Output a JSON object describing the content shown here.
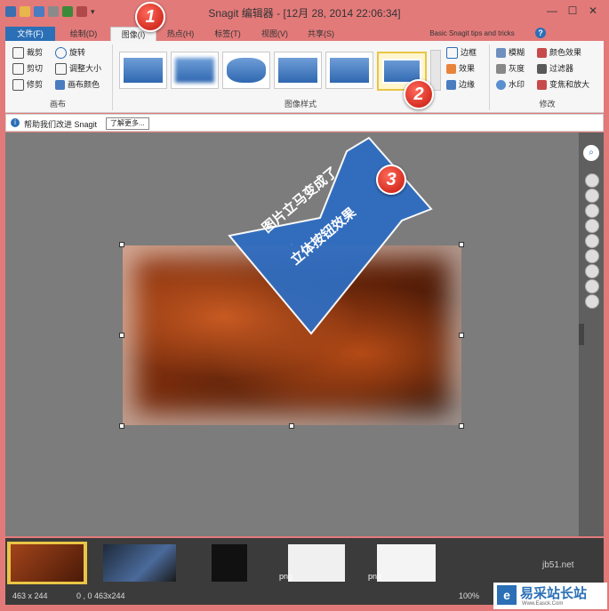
{
  "title_bar": {
    "title": "Snagit 编辑器 - [12月 28, 2014 22:06:34]",
    "minimize": "—",
    "maximize": "☐",
    "close": "✕"
  },
  "tabs": [
    {
      "label": "文件(F)"
    },
    {
      "label": "绘制(D)"
    },
    {
      "label": "图像(I)"
    },
    {
      "label": "热点(H)"
    },
    {
      "label": "标签(T)"
    },
    {
      "label": "视图(V)"
    },
    {
      "label": "共享(S)"
    }
  ],
  "tips_link": "Basic Snagit tips and tricks",
  "help_icon": "?",
  "canvas_group": {
    "crop": "裁剪",
    "rotate": "旋转",
    "cut": "剪切",
    "resize": "调整大小",
    "trim": "修剪",
    "canvas_color": "画布颜色",
    "label": "画布"
  },
  "styles_group": {
    "label": "图像样式",
    "border": "边框",
    "effects": "效果",
    "edges": "边缘"
  },
  "modify_group": {
    "label": "修改",
    "blur": "模糊",
    "color_effects": "颜色效果",
    "grayscale": "灰度",
    "filters": "过滤器",
    "watermark": "水印",
    "spotlight": "变焦和放大"
  },
  "infobar": {
    "text": "帮助我们改进 Snagit",
    "learn_more": "了解更多..."
  },
  "annotation": {
    "badge1": "1",
    "badge2": "2",
    "badge3": "3",
    "arrow_text_line1": "图片立马变成了",
    "arrow_text_line2": "立体按钮效果"
  },
  "filmstrip": {
    "png_label_1": "png",
    "png_label_2": "png"
  },
  "status": {
    "size": "463 x 244",
    "coords": "0 , 0  463x244",
    "zoom": "100%"
  },
  "watermark_logo": {
    "text": "易采站长站",
    "url_text": "Www.Easck.Com",
    "bg_text": "jb51.net"
  },
  "colors": {
    "window_frame": "#e37a7a",
    "file_tab": "#2b6fb6",
    "arrow": "#2f6dc1",
    "badge": "#d81f14"
  }
}
